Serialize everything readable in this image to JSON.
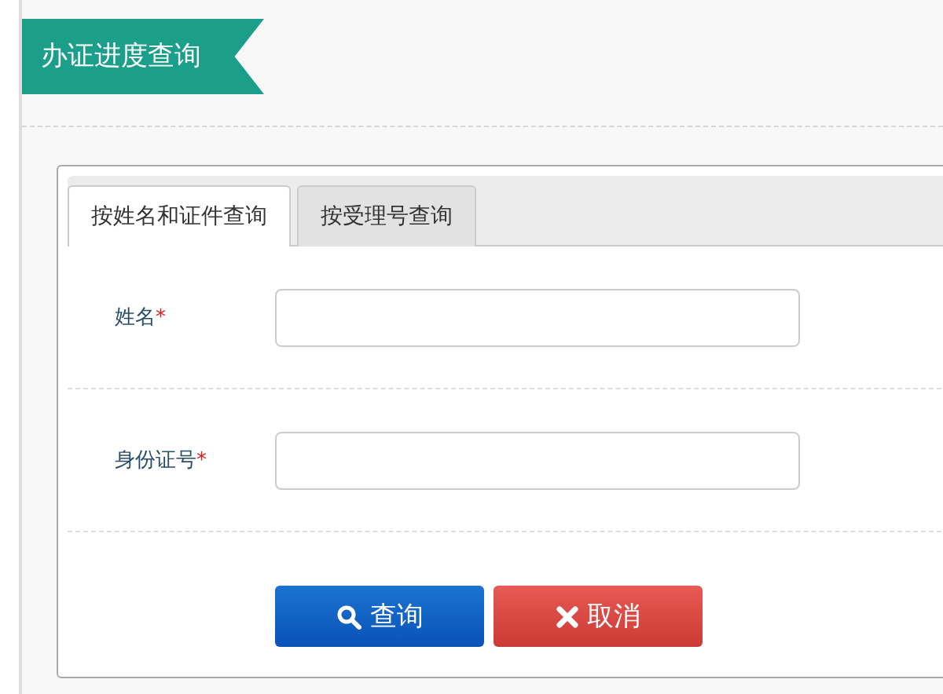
{
  "header": {
    "title": "办证进度查询"
  },
  "tabs": [
    {
      "label": "按姓名和证件查询",
      "selected": true
    },
    {
      "label": "按受理号查询",
      "selected": false
    }
  ],
  "fields": [
    {
      "label": "姓名",
      "required_mark": "*"
    },
    {
      "label": "身份证号",
      "required_mark": "*"
    }
  ],
  "buttons": [
    {
      "kind": "search",
      "label": "查询"
    },
    {
      "kind": "cancel",
      "label": "取消"
    }
  ]
}
